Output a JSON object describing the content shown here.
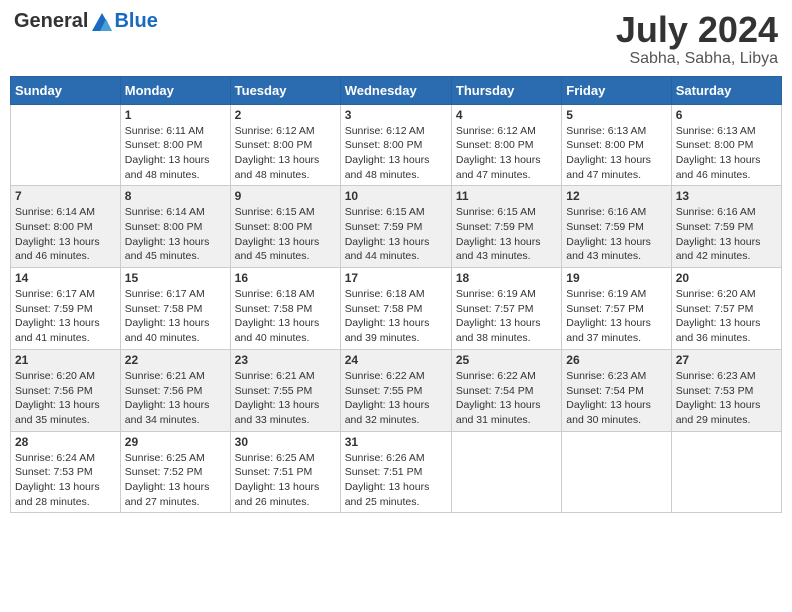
{
  "header": {
    "logo_general": "General",
    "logo_blue": "Blue",
    "month_year": "July 2024",
    "location": "Sabha, Sabha, Libya"
  },
  "weekdays": [
    "Sunday",
    "Monday",
    "Tuesday",
    "Wednesday",
    "Thursday",
    "Friday",
    "Saturday"
  ],
  "weeks": [
    [
      null,
      {
        "day": "1",
        "sunrise": "6:11 AM",
        "sunset": "8:00 PM",
        "daylight": "13 hours and 48 minutes."
      },
      {
        "day": "2",
        "sunrise": "6:12 AM",
        "sunset": "8:00 PM",
        "daylight": "13 hours and 48 minutes."
      },
      {
        "day": "3",
        "sunrise": "6:12 AM",
        "sunset": "8:00 PM",
        "daylight": "13 hours and 48 minutes."
      },
      {
        "day": "4",
        "sunrise": "6:12 AM",
        "sunset": "8:00 PM",
        "daylight": "13 hours and 47 minutes."
      },
      {
        "day": "5",
        "sunrise": "6:13 AM",
        "sunset": "8:00 PM",
        "daylight": "13 hours and 47 minutes."
      },
      {
        "day": "6",
        "sunrise": "6:13 AM",
        "sunset": "8:00 PM",
        "daylight": "13 hours and 46 minutes."
      }
    ],
    [
      {
        "day": "7",
        "sunrise": "6:14 AM",
        "sunset": "8:00 PM",
        "daylight": "13 hours and 46 minutes."
      },
      {
        "day": "8",
        "sunrise": "6:14 AM",
        "sunset": "8:00 PM",
        "daylight": "13 hours and 45 minutes."
      },
      {
        "day": "9",
        "sunrise": "6:15 AM",
        "sunset": "8:00 PM",
        "daylight": "13 hours and 45 minutes."
      },
      {
        "day": "10",
        "sunrise": "6:15 AM",
        "sunset": "7:59 PM",
        "daylight": "13 hours and 44 minutes."
      },
      {
        "day": "11",
        "sunrise": "6:15 AM",
        "sunset": "7:59 PM",
        "daylight": "13 hours and 43 minutes."
      },
      {
        "day": "12",
        "sunrise": "6:16 AM",
        "sunset": "7:59 PM",
        "daylight": "13 hours and 43 minutes."
      },
      {
        "day": "13",
        "sunrise": "6:16 AM",
        "sunset": "7:59 PM",
        "daylight": "13 hours and 42 minutes."
      }
    ],
    [
      {
        "day": "14",
        "sunrise": "6:17 AM",
        "sunset": "7:59 PM",
        "daylight": "13 hours and 41 minutes."
      },
      {
        "day": "15",
        "sunrise": "6:17 AM",
        "sunset": "7:58 PM",
        "daylight": "13 hours and 40 minutes."
      },
      {
        "day": "16",
        "sunrise": "6:18 AM",
        "sunset": "7:58 PM",
        "daylight": "13 hours and 40 minutes."
      },
      {
        "day": "17",
        "sunrise": "6:18 AM",
        "sunset": "7:58 PM",
        "daylight": "13 hours and 39 minutes."
      },
      {
        "day": "18",
        "sunrise": "6:19 AM",
        "sunset": "7:57 PM",
        "daylight": "13 hours and 38 minutes."
      },
      {
        "day": "19",
        "sunrise": "6:19 AM",
        "sunset": "7:57 PM",
        "daylight": "13 hours and 37 minutes."
      },
      {
        "day": "20",
        "sunrise": "6:20 AM",
        "sunset": "7:57 PM",
        "daylight": "13 hours and 36 minutes."
      }
    ],
    [
      {
        "day": "21",
        "sunrise": "6:20 AM",
        "sunset": "7:56 PM",
        "daylight": "13 hours and 35 minutes."
      },
      {
        "day": "22",
        "sunrise": "6:21 AM",
        "sunset": "7:56 PM",
        "daylight": "13 hours and 34 minutes."
      },
      {
        "day": "23",
        "sunrise": "6:21 AM",
        "sunset": "7:55 PM",
        "daylight": "13 hours and 33 minutes."
      },
      {
        "day": "24",
        "sunrise": "6:22 AM",
        "sunset": "7:55 PM",
        "daylight": "13 hours and 32 minutes."
      },
      {
        "day": "25",
        "sunrise": "6:22 AM",
        "sunset": "7:54 PM",
        "daylight": "13 hours and 31 minutes."
      },
      {
        "day": "26",
        "sunrise": "6:23 AM",
        "sunset": "7:54 PM",
        "daylight": "13 hours and 30 minutes."
      },
      {
        "day": "27",
        "sunrise": "6:23 AM",
        "sunset": "7:53 PM",
        "daylight": "13 hours and 29 minutes."
      }
    ],
    [
      {
        "day": "28",
        "sunrise": "6:24 AM",
        "sunset": "7:53 PM",
        "daylight": "13 hours and 28 minutes."
      },
      {
        "day": "29",
        "sunrise": "6:25 AM",
        "sunset": "7:52 PM",
        "daylight": "13 hours and 27 minutes."
      },
      {
        "day": "30",
        "sunrise": "6:25 AM",
        "sunset": "7:51 PM",
        "daylight": "13 hours and 26 minutes."
      },
      {
        "day": "31",
        "sunrise": "6:26 AM",
        "sunset": "7:51 PM",
        "daylight": "13 hours and 25 minutes."
      },
      null,
      null,
      null
    ]
  ]
}
